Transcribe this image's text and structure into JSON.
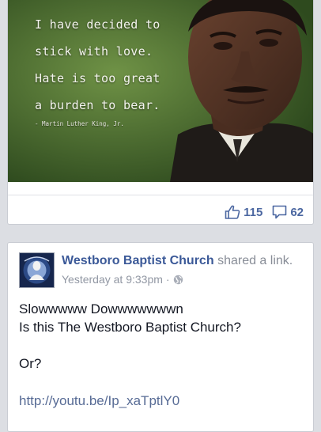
{
  "quote_post": {
    "quote_lines": [
      "I have decided to",
      "stick with love.",
      "Hate is too great",
      "a burden to bear."
    ],
    "attribution": "- Martin Luther King, Jr.",
    "like_count": "115",
    "comment_count": "62"
  },
  "shared_post": {
    "author": "Westboro Baptist Church",
    "action": "shared a link.",
    "timestamp": "Yesterday at 9:33pm",
    "separator": "·",
    "privacy_icon": "globe-icon",
    "body_lines": [
      "Slowwwww Dowwwwwwwn",
      "Is this The Westboro Baptist Church?",
      "",
      "Or?"
    ],
    "link": "http://youtu.be/Ip_xaTptlY0"
  },
  "colors": {
    "facebook_blue": "#3b5998",
    "stat_blue": "#4b67a1",
    "meta_gray": "#9197a3",
    "background": "#dcdee3"
  }
}
